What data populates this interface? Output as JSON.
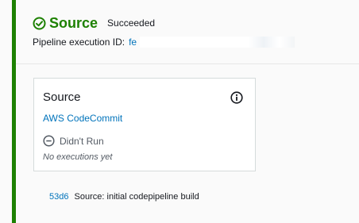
{
  "stage": {
    "name": "Source",
    "status": "Succeeded",
    "status_icon": "check-circle-icon",
    "execution_id_label": "Pipeline execution ID:",
    "execution_id_value": "fe"
  },
  "action": {
    "name": "Source",
    "info_icon": "info-icon",
    "provider": "AWS CodeCommit",
    "run_status": "Didn't Run",
    "run_status_icon": "minus-circle-icon",
    "executions_note": "No executions yet"
  },
  "revision": {
    "commit_id": "53d6",
    "message": "Source: initial codepipeline build"
  },
  "colors": {
    "success": "#1d8102",
    "link": "#0073bb",
    "muted": "#545b64"
  }
}
